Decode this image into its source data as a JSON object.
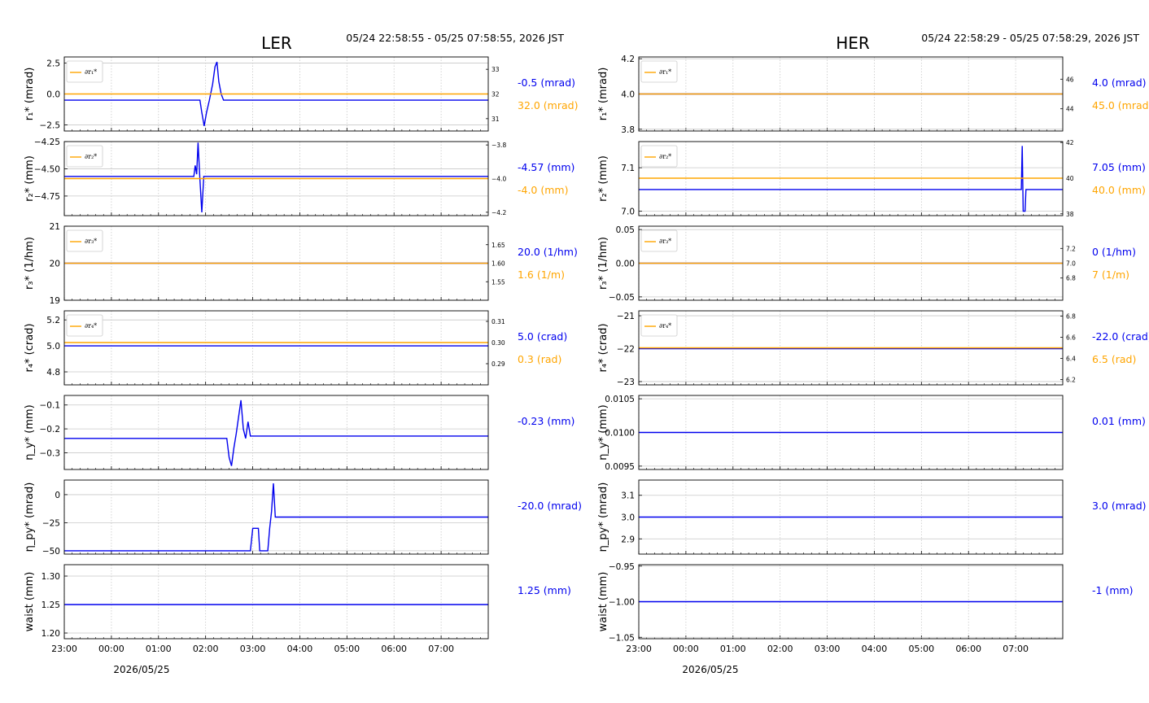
{
  "colors": {
    "primary": "#0000ee",
    "secondary": "#ffa500",
    "grid": "#c8c8c8"
  },
  "chart_data": [
    {
      "name": "LER",
      "title": "LER",
      "time_range": "05/24 22:58:55 - 05/25 07:58:55, 2026 JST",
      "date_label": "2026/05/25",
      "x_ticks": [
        "23:00",
        "00:00",
        "01:00",
        "02:00",
        "03:00",
        "04:00",
        "05:00",
        "06:00",
        "07:00"
      ],
      "x_range_hours": [
        23.0,
        32.0
      ],
      "panels": [
        {
          "type": "line",
          "ylabel": "r₁* (mrad)",
          "ylim": [
            -3.0,
            3.0
          ],
          "yticks": [
            "2.5",
            "0.0",
            "−2.5"
          ],
          "ytick_values": [
            2.5,
            0.0,
            -2.5
          ],
          "series": [
            {
              "role": "main",
              "values": [
                [
                  23.0,
                  -0.5
                ],
                [
                  25.88,
                  -0.5
                ],
                [
                  25.92,
                  -1.5
                ],
                [
                  25.97,
                  -2.6
                ],
                [
                  26.02,
                  -1.5
                ],
                [
                  26.08,
                  -0.5
                ],
                [
                  26.15,
                  0.8
                ],
                [
                  26.2,
                  2.2
                ],
                [
                  26.24,
                  2.6
                ],
                [
                  26.28,
                  1.0
                ],
                [
                  26.33,
                  0.0
                ],
                [
                  26.38,
                  -0.5
                ],
                [
                  32.0,
                  -0.5
                ]
              ]
            },
            {
              "role": "secondary",
              "values": [
                [
                  23.0,
                  32.0
                ],
                [
                  32.0,
                  32.0
                ]
              ]
            }
          ],
          "y2lim": [
            30.5,
            33.5
          ],
          "y2ticks": [
            "33",
            "32",
            "31"
          ],
          "y2tick_values": [
            33,
            32,
            31
          ],
          "legend": "∂r₁*",
          "readout": "-0.5 (mrad)",
          "readout2": "32.0 (mrad)"
        },
        {
          "type": "line",
          "ylabel": "r₂* (mm)",
          "ylim": [
            -4.93,
            -4.25
          ],
          "yticks": [
            "−4.25",
            "−4.50",
            "−4.75"
          ],
          "ytick_values": [
            -4.25,
            -4.5,
            -4.75
          ],
          "series": [
            {
              "role": "main",
              "values": [
                [
                  23.0,
                  -4.57
                ],
                [
                  25.75,
                  -4.57
                ],
                [
                  25.78,
                  -4.47
                ],
                [
                  25.81,
                  -4.55
                ],
                [
                  25.84,
                  -4.26
                ],
                [
                  25.88,
                  -4.6
                ],
                [
                  25.92,
                  -4.9
                ],
                [
                  25.96,
                  -4.57
                ],
                [
                  32.0,
                  -4.57
                ]
              ]
            },
            {
              "role": "secondary",
              "values": [
                [
                  23.0,
                  -4.0
                ],
                [
                  32.0,
                  -4.0
                ]
              ]
            }
          ],
          "y2lim": [
            -4.22,
            -3.78
          ],
          "y2ticks": [
            "−3.8",
            "−4.0",
            "−4.2"
          ],
          "y2tick_values": [
            -3.8,
            -4.0,
            -4.2
          ],
          "legend": "∂r₂*",
          "readout": "-4.57 (mm)",
          "readout2": "-4.0 (mm)"
        },
        {
          "type": "line",
          "ylabel": "r₃* (1/hm)",
          "ylim": [
            19.0,
            21.0
          ],
          "yticks": [
            "21",
            "20",
            "19"
          ],
          "ytick_values": [
            21,
            20,
            19
          ],
          "series": [
            {
              "role": "main",
              "values": [
                [
                  23.0,
                  20.0
                ],
                [
                  32.0,
                  20.0
                ]
              ]
            },
            {
              "role": "secondary",
              "values": [
                [
                  23.0,
                  1.6
                ],
                [
                  32.0,
                  1.6
                ]
              ]
            }
          ],
          "y2lim": [
            1.5,
            1.7
          ],
          "y2ticks": [
            "1.65",
            "1.60",
            "1.55"
          ],
          "y2tick_values": [
            1.65,
            1.6,
            1.55
          ],
          "legend": "∂r₃*",
          "readout": "20.0 (1/hm)",
          "readout2": "1.6 (1/m)"
        },
        {
          "type": "line",
          "ylabel": "r₄* (crad)",
          "ylim": [
            4.7,
            5.27
          ],
          "yticks": [
            "5.2",
            "5.0",
            "4.8"
          ],
          "ytick_values": [
            5.2,
            5.0,
            4.8
          ],
          "series": [
            {
              "role": "main",
              "values": [
                [
                  23.0,
                  5.0
                ],
                [
                  32.0,
                  5.0
                ]
              ]
            },
            {
              "role": "secondary",
              "values": [
                [
                  23.0,
                  0.3
                ],
                [
                  32.0,
                  0.3
                ]
              ]
            }
          ],
          "y2lim": [
            0.28,
            0.315
          ],
          "y2ticks": [
            "0.31",
            "0.30",
            "0.29"
          ],
          "y2tick_values": [
            0.31,
            0.3,
            0.29
          ],
          "legend": "∂r₄*",
          "readout": "5.0 (crad)",
          "readout2": "0.3 (rad)"
        },
        {
          "type": "line",
          "ylabel": "η_y* (mm)",
          "ylim": [
            -0.37,
            -0.06
          ],
          "yticks": [
            "−0.1",
            "−0.2",
            "−0.3"
          ],
          "ytick_values": [
            -0.1,
            -0.2,
            -0.3
          ],
          "series": [
            {
              "role": "main",
              "values": [
                [
                  23.0,
                  -0.24
                ],
                [
                  26.45,
                  -0.24
                ],
                [
                  26.5,
                  -0.32
                ],
                [
                  26.55,
                  -0.355
                ],
                [
                  26.6,
                  -0.28
                ],
                [
                  26.65,
                  -0.22
                ],
                [
                  26.7,
                  -0.15
                ],
                [
                  26.75,
                  -0.08
                ],
                [
                  26.8,
                  -0.2
                ],
                [
                  26.85,
                  -0.24
                ],
                [
                  26.9,
                  -0.17
                ],
                [
                  26.95,
                  -0.23
                ],
                [
                  32.0,
                  -0.23
                ]
              ]
            }
          ],
          "readout": "-0.23 (mm)"
        },
        {
          "type": "line",
          "ylabel": "η_py* (mrad)",
          "ylim": [
            -53,
            13
          ],
          "yticks": [
            "0",
            "−25",
            "−50"
          ],
          "ytick_values": [
            0,
            -25,
            -50
          ],
          "series": [
            {
              "role": "main",
              "values": [
                [
                  23.0,
                  -50
                ],
                [
                  26.95,
                  -50
                ],
                [
                  27.0,
                  -30
                ],
                [
                  27.12,
                  -30
                ],
                [
                  27.15,
                  -50
                ],
                [
                  27.32,
                  -50
                ],
                [
                  27.36,
                  -30
                ],
                [
                  27.4,
                  -15
                ],
                [
                  27.44,
                  10
                ],
                [
                  27.48,
                  -20
                ],
                [
                  32.0,
                  -20
                ]
              ]
            }
          ],
          "readout": "-20.0 (mrad)"
        },
        {
          "type": "line",
          "ylabel": "waist (mm)",
          "ylim": [
            1.19,
            1.32
          ],
          "yticks": [
            "1.30",
            "1.25",
            "1.20"
          ],
          "ytick_values": [
            1.3,
            1.25,
            1.2
          ],
          "series": [
            {
              "role": "main",
              "values": [
                [
                  23.0,
                  1.25
                ],
                [
                  32.0,
                  1.25
                ]
              ]
            }
          ],
          "readout": "1.25 (mm)"
        }
      ]
    },
    {
      "name": "HER",
      "title": "HER",
      "time_range": "05/24 22:58:29 - 05/25 07:58:29, 2026 JST",
      "date_label": "2026/05/25",
      "x_ticks": [
        "23:00",
        "00:00",
        "01:00",
        "02:00",
        "03:00",
        "04:00",
        "05:00",
        "06:00",
        "07:00"
      ],
      "x_range_hours": [
        23.0,
        32.0
      ],
      "panels": [
        {
          "type": "line",
          "ylabel": "r₁* (mrad)",
          "ylim": [
            3.79,
            4.21
          ],
          "yticks": [
            "4.2",
            "4.0",
            "3.8"
          ],
          "ytick_values": [
            4.2,
            4.0,
            3.8
          ],
          "series": [
            {
              "role": "main",
              "values": [
                [
                  23.0,
                  4.0
                ],
                [
                  32.0,
                  4.0
                ]
              ]
            },
            {
              "role": "secondary",
              "values": [
                [
                  23.0,
                  45.0
                ],
                [
                  32.0,
                  45.0
                ]
              ]
            }
          ],
          "y2lim": [
            42.5,
            47.5
          ],
          "y2ticks": [
            "46",
            "44"
          ],
          "y2tick_values": [
            46,
            44
          ],
          "legend": "∂r₁*",
          "readout": "4.0 (mrad)",
          "readout2": "45.0 (mrad)"
        },
        {
          "type": "line",
          "ylabel": "r₂* (mm)",
          "ylim": [
            6.99,
            7.16
          ],
          "yticks": [
            "7.1",
            "7.0"
          ],
          "ytick_values": [
            7.1,
            7.0
          ],
          "series": [
            {
              "role": "main",
              "values": [
                [
                  23.0,
                  7.05
                ],
                [
                  31.12,
                  7.05
                ],
                [
                  31.14,
                  7.15
                ],
                [
                  31.16,
                  7.0
                ],
                [
                  31.2,
                  7.0
                ],
                [
                  31.22,
                  7.05
                ],
                [
                  32.0,
                  7.05
                ]
              ]
            },
            {
              "role": "secondary",
              "values": [
                [
                  23.0,
                  40.0
                ],
                [
                  32.0,
                  40.0
                ]
              ]
            }
          ],
          "y2lim": [
            37.9,
            42.05
          ],
          "y2ticks": [
            "42",
            "40",
            "38"
          ],
          "y2tick_values": [
            42,
            40,
            38
          ],
          "legend": "∂r₂*",
          "readout": "7.05 (mm)",
          "readout2": "40.0 (mm)"
        },
        {
          "type": "line",
          "ylabel": "r₃* (1/hm)",
          "ylim": [
            -0.055,
            0.055
          ],
          "yticks": [
            "0.05",
            "0.00",
            "−0.05"
          ],
          "ytick_values": [
            0.05,
            0.0,
            -0.05
          ],
          "series": [
            {
              "role": "main",
              "values": [
                [
                  23.0,
                  0.0
                ],
                [
                  32.0,
                  0.0
                ]
              ]
            },
            {
              "role": "secondary",
              "values": [
                [
                  23.0,
                  7.0
                ],
                [
                  32.0,
                  7.0
                ]
              ]
            }
          ],
          "y2lim": [
            6.5,
            7.5
          ],
          "y2ticks": [
            "7.2",
            "7.0",
            "6.8"
          ],
          "y2tick_values": [
            7.2,
            7.0,
            6.8
          ],
          "legend": "∂r₃*",
          "readout": "0 (1/hm)",
          "readout2": "7 (1/m)"
        },
        {
          "type": "line",
          "ylabel": "r₄* (crad)",
          "ylim": [
            -23.1,
            -20.85
          ],
          "yticks": [
            "−21",
            "−22",
            "−23"
          ],
          "ytick_values": [
            -21,
            -22,
            -23
          ],
          "series": [
            {
              "role": "main",
              "values": [
                [
                  23.0,
                  -22.0
                ],
                [
                  32.0,
                  -22.0
                ]
              ]
            },
            {
              "role": "secondary",
              "values": [
                [
                  23.0,
                  6.5
                ],
                [
                  32.0,
                  6.5
                ]
              ]
            }
          ],
          "y2lim": [
            6.15,
            6.85
          ],
          "y2ticks": [
            "6.8",
            "6.6",
            "6.4",
            "6.2"
          ],
          "y2tick_values": [
            6.8,
            6.6,
            6.4,
            6.2
          ],
          "legend": "∂r₄*",
          "readout": "-22.0 (crad)",
          "readout2": "6.5 (rad)"
        },
        {
          "type": "line",
          "ylabel": "η_y* (mm)",
          "ylim": [
            0.00945,
            0.01055
          ],
          "yticks": [
            "0.0105",
            "0.0100",
            "0.0095"
          ],
          "ytick_values": [
            0.0105,
            0.01,
            0.0095
          ],
          "series": [
            {
              "role": "main",
              "values": [
                [
                  23.0,
                  0.01
                ],
                [
                  32.0,
                  0.01
                ]
              ]
            }
          ],
          "readout": "0.01 (mm)"
        },
        {
          "type": "line",
          "ylabel": "η_py* (mrad)",
          "ylim": [
            2.83,
            3.17
          ],
          "yticks": [
            "3.1",
            "3.0",
            "2.9"
          ],
          "ytick_values": [
            3.1,
            3.0,
            2.9
          ],
          "series": [
            {
              "role": "main",
              "values": [
                [
                  23.0,
                  3.0
                ],
                [
                  32.0,
                  3.0
                ]
              ]
            }
          ],
          "readout": "3.0 (mrad)"
        },
        {
          "type": "line",
          "ylabel": "waist (mm)",
          "ylim": [
            -1.052,
            -0.948
          ],
          "yticks": [
            "−0.95",
            "−1.00",
            "−1.05"
          ],
          "ytick_values": [
            -0.95,
            -1.0,
            -1.05
          ],
          "series": [
            {
              "role": "main",
              "values": [
                [
                  23.0,
                  -1.0
                ],
                [
                  32.0,
                  -1.0
                ]
              ]
            }
          ],
          "readout": "-1 (mm)"
        }
      ]
    }
  ]
}
